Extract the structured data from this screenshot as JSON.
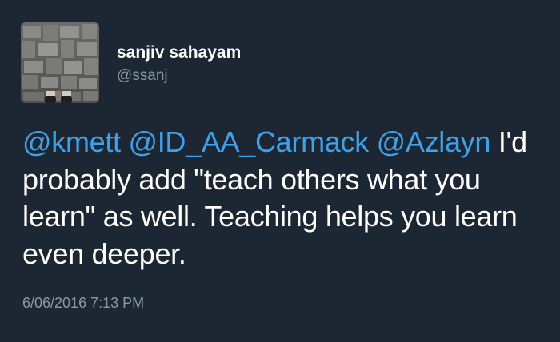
{
  "tweet": {
    "author": {
      "display_name": "sanjiv sahayam",
      "handle": "@ssanj"
    },
    "mentions": [
      "@kmett",
      "@ID_AA_Carmack",
      "@Azlayn"
    ],
    "body_text": "I'd probably add \"teach others what you learn\" as well. Teaching helps you learn even deeper.",
    "timestamp": "6/06/2016 7:13 PM"
  },
  "colors": {
    "background": "#1c2733",
    "mention": "#3ea1ec",
    "secondary_text": "#8899a6",
    "divider": "#38444d"
  },
  "icons": {
    "avatar": "avatar-photo-feet-on-tiled-floor"
  }
}
